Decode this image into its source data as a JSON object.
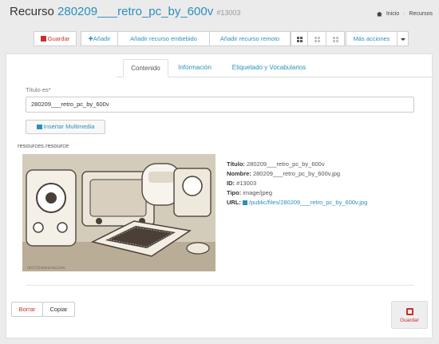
{
  "header": {
    "title_prefix": "Recurso",
    "resource_name": "280209___retro_pc_by_600v",
    "resource_id": "#13003",
    "breadcrumb": [
      "Inicio",
      "Recursos"
    ]
  },
  "toolbar": {
    "save_label": "Guardar",
    "add_label": "Añadir",
    "add_embedded_label": "Añadir recurso embebido",
    "add_remote_label": "Añadir recurso remoto",
    "more_actions_label": "Más acciones"
  },
  "tabs": [
    {
      "label": "Contenido",
      "active": true
    },
    {
      "label": "Información",
      "active": false
    },
    {
      "label": "Etiquetado y Vocabularios",
      "active": false
    }
  ],
  "form": {
    "title_label": "Título es*",
    "title_value": "280209___retro_pc_by_600v",
    "media_button_label": "Insertar Multimedia",
    "resource_label": "resources.resource",
    "image_caption": "rdn13.livejournal.com"
  },
  "details": {
    "title_key": "Título:",
    "title_val": "280209___retro_pc_by_600v",
    "name_key": "Nombre:",
    "name_val": "280209___retro_pc_by_600v.jpg",
    "id_key": "ID:",
    "id_val": "#13003",
    "type_key": "Tipo:",
    "type_val": "image/jpeg",
    "url_key": "URL:",
    "url_val": "/public/files/280209___retro_pc_by_600v.jpg"
  },
  "footer": {
    "delete_label": "Borrar",
    "copy_label": "Copiar",
    "save_label": "Guardar"
  },
  "colors": {
    "accent": "#2a8fbd",
    "danger": "#c9302c",
    "background": "#ebebeb"
  }
}
